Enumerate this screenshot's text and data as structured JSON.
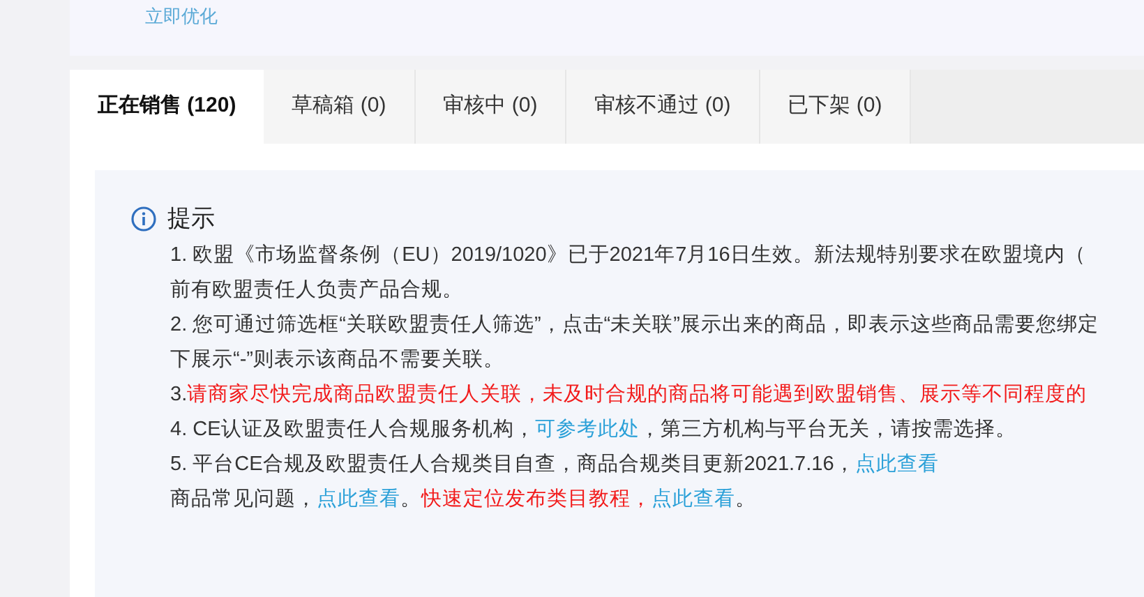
{
  "top_link": "立即优化",
  "tabs": [
    {
      "label": "正在销售 (120)",
      "selected": true
    },
    {
      "label": "草稿箱 (0)",
      "selected": false
    },
    {
      "label": "审核中 (0)",
      "selected": false
    },
    {
      "label": "审核不通过 (0)",
      "selected": false
    },
    {
      "label": "已下架 (0)",
      "selected": false
    }
  ],
  "notice": {
    "title": "提示",
    "lines": [
      [
        {
          "kind": "text",
          "text": "1. 欧盟《市场监督条例（EU）2019/1020》已于2021年7月16日生效。新法规特别要求在欧盟境内（"
        }
      ],
      [
        {
          "kind": "text",
          "text": "前有欧盟责任人负责产品合规。"
        }
      ],
      [
        {
          "kind": "text",
          "text": "2. 您可通过筛选框“关联欧盟责任人筛选”，点击“未关联”展示出来的商品，即表示这些商品需要您绑定"
        }
      ],
      [
        {
          "kind": "text",
          "text": "下展示“-”则表示该商品不需要关联。"
        }
      ],
      [
        {
          "kind": "text",
          "text": "3. "
        },
        {
          "kind": "warning",
          "text": "请商家尽快完成商品欧盟责任人关联，未及时合规的商品将可能遇到欧盟销售、展示等不同程度的"
        }
      ],
      [
        {
          "kind": "text",
          "text": "4. CE认证及欧盟责任人合规服务机构，"
        },
        {
          "kind": "link",
          "text": "可参考此处"
        },
        {
          "kind": "text",
          "text": "，第三方机构与平台无关，请按需选择。"
        }
      ],
      [
        {
          "kind": "text",
          "text": "5. 平台CE合规及欧盟责任人合规类目自查，商品合规类目更新2021.7.16，"
        },
        {
          "kind": "link",
          "text": "点此查看"
        }
      ],
      [
        {
          "kind": "text",
          "text": "商品常见问题，"
        },
        {
          "kind": "link",
          "text": "点此查看"
        },
        {
          "kind": "text",
          "text": "。"
        },
        {
          "kind": "warning",
          "text": "快速定位发布类目教程，"
        },
        {
          "kind": "link",
          "text": "点此查看"
        },
        {
          "kind": "text",
          "text": "。"
        }
      ]
    ]
  }
}
